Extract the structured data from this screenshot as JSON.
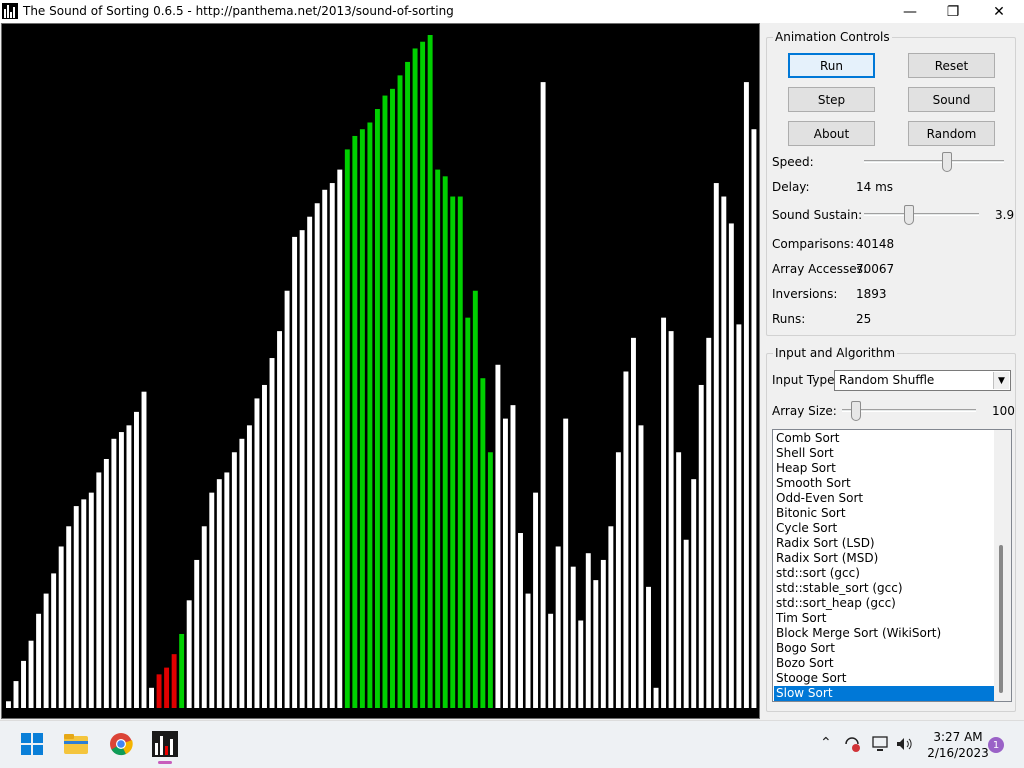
{
  "window": {
    "title": "The Sound of Sorting 0.6.5 - http://panthema.net/2013/sound-of-sorting",
    "minimize": "—",
    "maximize": "❐",
    "close": "✕"
  },
  "colors": {
    "bar_white": "#ffffff",
    "bar_red": "#e00000",
    "bar_green": "#00d000",
    "background": "#000000"
  },
  "array": {
    "values": [
      1,
      4,
      7,
      10,
      14,
      17,
      20,
      24,
      27,
      30,
      31,
      32,
      35,
      37,
      40,
      41,
      42,
      44,
      47,
      3,
      5,
      6,
      8,
      11,
      16,
      22,
      27,
      32,
      34,
      35,
      38,
      40,
      42,
      46,
      48,
      52,
      56,
      62,
      70,
      71,
      73,
      75,
      77,
      78,
      80,
      83,
      85,
      86,
      87,
      89,
      91,
      92,
      94,
      96,
      98,
      99,
      100,
      80,
      79,
      76,
      76,
      58,
      62,
      49,
      38,
      51,
      43,
      45,
      26,
      17,
      32,
      93,
      14,
      24,
      43,
      21,
      13,
      23,
      19,
      22,
      27,
      38,
      50,
      55,
      42,
      18,
      3,
      58,
      56,
      38,
      25,
      34,
      48,
      55,
      78,
      76,
      72,
      57,
      93,
      86
    ],
    "states": [
      "w",
      "w",
      "w",
      "w",
      "w",
      "w",
      "w",
      "w",
      "w",
      "w",
      "w",
      "w",
      "w",
      "w",
      "w",
      "w",
      "w",
      "w",
      "w",
      "w",
      "r",
      "r",
      "r",
      "g",
      "w",
      "w",
      "w",
      "w",
      "w",
      "w",
      "w",
      "w",
      "w",
      "w",
      "w",
      "w",
      "w",
      "w",
      "w",
      "w",
      "w",
      "w",
      "w",
      "w",
      "w",
      "g",
      "g",
      "g",
      "g",
      "g",
      "g",
      "g",
      "g",
      "g",
      "g",
      "g",
      "g",
      "g",
      "g",
      "g",
      "g",
      "g",
      "g",
      "g",
      "g",
      "w",
      "w",
      "w",
      "w",
      "w",
      "w",
      "w",
      "w",
      "w",
      "w",
      "w",
      "w",
      "w",
      "w",
      "w",
      "w",
      "w",
      "w",
      "w",
      "w",
      "w",
      "w",
      "w",
      "w",
      "w",
      "w",
      "w",
      "w",
      "w",
      "w",
      "w",
      "w",
      "w",
      "w",
      "w"
    ]
  },
  "controls": {
    "group_title": "Animation Controls",
    "run": "Run",
    "reset": "Reset",
    "step": "Step",
    "sound": "Sound",
    "about": "About",
    "random": "Random",
    "speed_label": "Speed:",
    "speed_level": 0.6,
    "delay_label": "Delay:",
    "delay_value": "14 ms",
    "sustain_label": "Sound Sustain:",
    "sustain_value": "3.9",
    "sustain_level": 0.38,
    "comparisons_label": "Comparisons:",
    "comparisons_value": "40148",
    "accesses_label": "Array Accesses:",
    "accesses_value": "70067",
    "inversions_label": "Inversions:",
    "inversions_value": "1893",
    "runs_label": "Runs:",
    "runs_value": "25"
  },
  "input": {
    "group_title": "Input and Algorithm",
    "type_label": "Input Type:",
    "type_value": "Random Shuffle",
    "size_label": "Array Size:",
    "size_value": "100",
    "size_level": 0.07,
    "algorithms": [
      "Comb Sort",
      "Shell Sort",
      "Heap Sort",
      "Smooth Sort",
      "Odd-Even Sort",
      "Bitonic Sort",
      "Cycle Sort",
      "Radix Sort (LSD)",
      "Radix Sort (MSD)",
      "std::sort (gcc)",
      "std::stable_sort (gcc)",
      "std::sort_heap (gcc)",
      "Tim Sort",
      "Block Merge Sort (WikiSort)",
      "Bogo Sort",
      "Bozo Sort",
      "Stooge Sort",
      "Slow Sort"
    ],
    "selected_algorithm": "Slow Sort"
  },
  "taskbar": {
    "time": "3:27 AM",
    "date": "2/16/2023",
    "notifications": "1",
    "apps": [
      "windows-start-icon",
      "file-explorer-icon",
      "chrome-icon",
      "sound-of-sorting-icon"
    ]
  }
}
